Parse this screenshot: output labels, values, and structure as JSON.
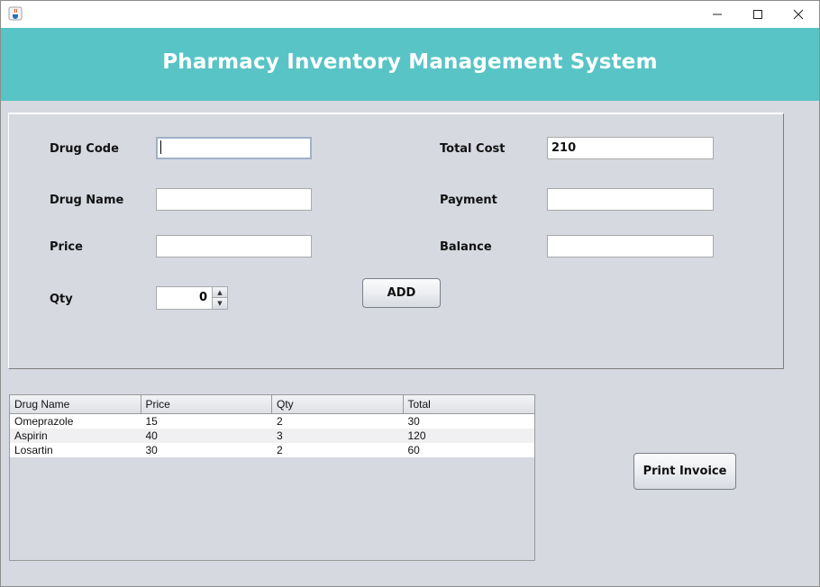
{
  "window": {
    "icon": "java-cup-icon",
    "controls": [
      "minimize-icon",
      "maximize-icon",
      "close-icon"
    ]
  },
  "header": {
    "title": "Pharmacy Inventory Management System",
    "background": "#58c4c6"
  },
  "form": {
    "drug_code": {
      "label": "Drug Code",
      "value": ""
    },
    "drug_name": {
      "label": "Drug Name",
      "value": ""
    },
    "price": {
      "label": "Price",
      "value": ""
    },
    "qty": {
      "label": "Qty",
      "value": "0"
    },
    "total_cost": {
      "label": "Total Cost",
      "value": "210"
    },
    "payment": {
      "label": "Payment",
      "value": ""
    },
    "balance": {
      "label": "Balance",
      "value": ""
    },
    "add_label": "ADD"
  },
  "table": {
    "columns": [
      "Drug Name",
      "Price",
      "Qty",
      "Total"
    ],
    "rows": [
      [
        "Omeprazole",
        "15",
        "2",
        "30"
      ],
      [
        "Aspirin",
        "40",
        "3",
        "120"
      ],
      [
        "Losartin",
        "30",
        "2",
        "60"
      ]
    ]
  },
  "actions": {
    "print_invoice_label": "Print Invoice"
  }
}
